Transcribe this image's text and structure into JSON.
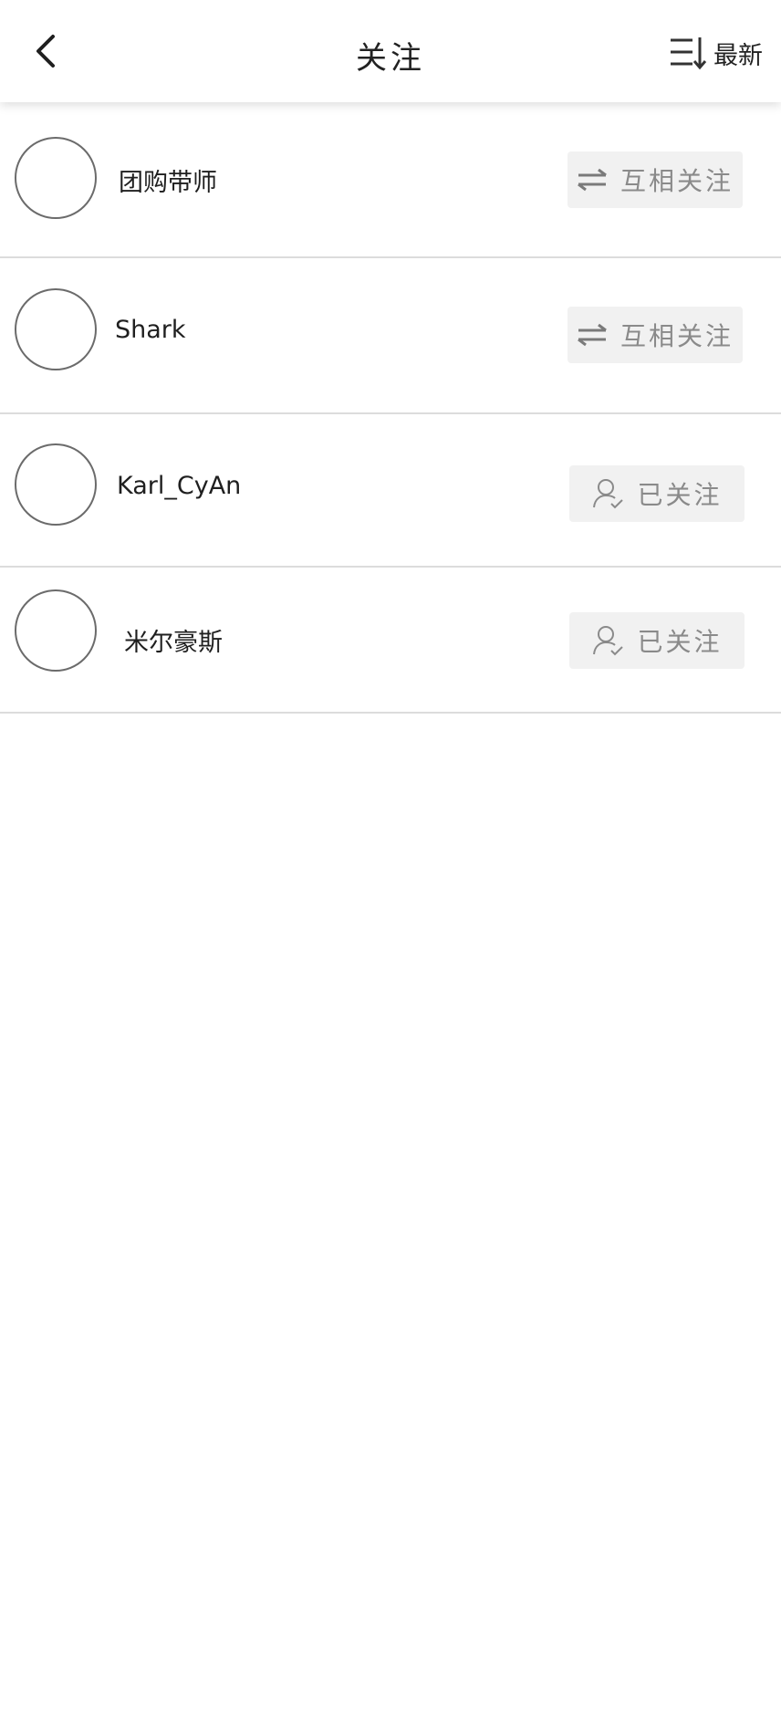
{
  "header": {
    "title": "关注",
    "sort_label": "最新",
    "back_icon": "chevron-left-icon",
    "sort_icon": "sort-descending-icon"
  },
  "colors": {
    "button_bg": "#f1f1f1",
    "button_text": "#8a8a8a",
    "divider": "#dcdcdc",
    "avatar_border": "#6b6b6b"
  },
  "follows": [
    {
      "name": "团购带师",
      "button_label": "互相关注",
      "button_icon": "swap-arrows-icon"
    },
    {
      "name": "Shark",
      "button_label": "互相关注",
      "button_icon": "swap-arrows-icon"
    },
    {
      "name": "Karl_CyAn",
      "button_label": "已关注",
      "button_icon": "user-check-icon"
    },
    {
      "name": "米尔豪斯",
      "button_label": "已关注",
      "button_icon": "user-check-icon"
    }
  ]
}
